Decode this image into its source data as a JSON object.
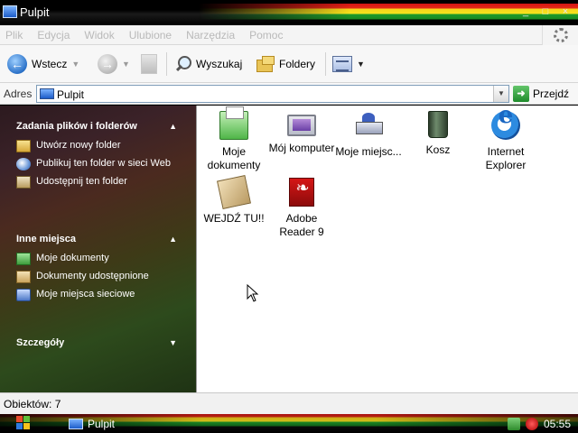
{
  "window": {
    "title": "Pulpit",
    "controls": [
      "_",
      "□",
      "×"
    ]
  },
  "menu": {
    "items": [
      "Plik",
      "Edycja",
      "Widok",
      "Ulubione",
      "Narzędzia",
      "Pomoc"
    ]
  },
  "toolbar": {
    "back_label": "Wstecz",
    "search_label": "Wyszukaj",
    "folders_label": "Foldery"
  },
  "address": {
    "label": "Adres",
    "value": "Pulpit",
    "go_label": "Przejdź"
  },
  "taskpane": {
    "file_tasks": {
      "title": "Zadania plików i folderów",
      "items": [
        {
          "label": "Utwórz nowy folder",
          "icon": "new-folder-icon"
        },
        {
          "label": "Publikuj ten folder w sieci Web",
          "icon": "publish-web-icon"
        },
        {
          "label": "Udostępnij ten folder",
          "icon": "share-folder-icon"
        }
      ]
    },
    "other_places": {
      "title": "Inne miejsca",
      "items": [
        {
          "label": "Moje dokumenty",
          "icon": "my-documents-icon"
        },
        {
          "label": "Dokumenty udostępnione",
          "icon": "shared-documents-icon"
        },
        {
          "label": "Moje miejsca sieciowe",
          "icon": "network-places-icon"
        }
      ]
    },
    "details": {
      "title": "Szczegóły"
    }
  },
  "content": {
    "items": [
      {
        "label": "Moje dokumenty",
        "icon": "my-documents-icon"
      },
      {
        "label": "Mój komputer",
        "icon": "my-computer-icon"
      },
      {
        "label": "Moje miejsc...",
        "icon": "network-places-icon"
      },
      {
        "label": "Kosz",
        "icon": "recycle-bin-icon"
      },
      {
        "label": "Internet Explorer",
        "icon": "internet-explorer-icon"
      },
      {
        "label": "WEJDŹ TU!!",
        "icon": "shortcut-icon"
      },
      {
        "label": "Adobe Reader 9",
        "icon": "adobe-reader-icon"
      }
    ]
  },
  "status": {
    "text": "Obiektów: 7"
  },
  "taskbar": {
    "window_button": "Pulpit",
    "clock": "05:55"
  },
  "colors": {
    "accent_red": "#d41414",
    "accent_yellow": "#f6d51a",
    "accent_green": "#1f9a2a"
  }
}
